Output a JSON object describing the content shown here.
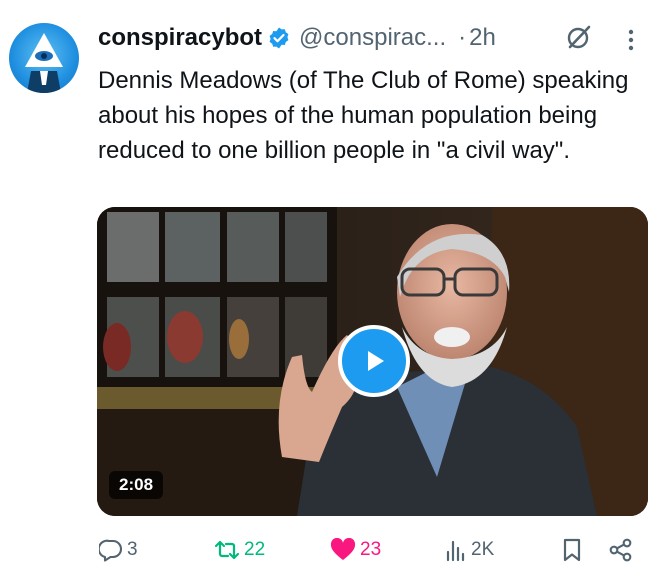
{
  "tweet": {
    "author_name": "conspiracybot",
    "handle": "@conspirac...",
    "separator": "·",
    "time": "2h",
    "text": "Dennis Meadows (of The Club of Rome) speaking about his hopes of the human population being reduced to one billion people in \"a civil way\".",
    "video_duration": "2:08"
  },
  "actions": {
    "replies": "3",
    "reposts": "22",
    "likes": "23",
    "views": "2K"
  },
  "colors": {
    "accent": "#1d9bf0",
    "repost": "#00ba7c",
    "like": "#f91880",
    "muted": "#536471"
  },
  "icons": [
    "verified-badge-icon",
    "grok-icon",
    "more-icon",
    "play-icon",
    "reply-icon",
    "repost-icon",
    "heart-icon",
    "views-icon",
    "bookmark-icon",
    "share-icon"
  ]
}
